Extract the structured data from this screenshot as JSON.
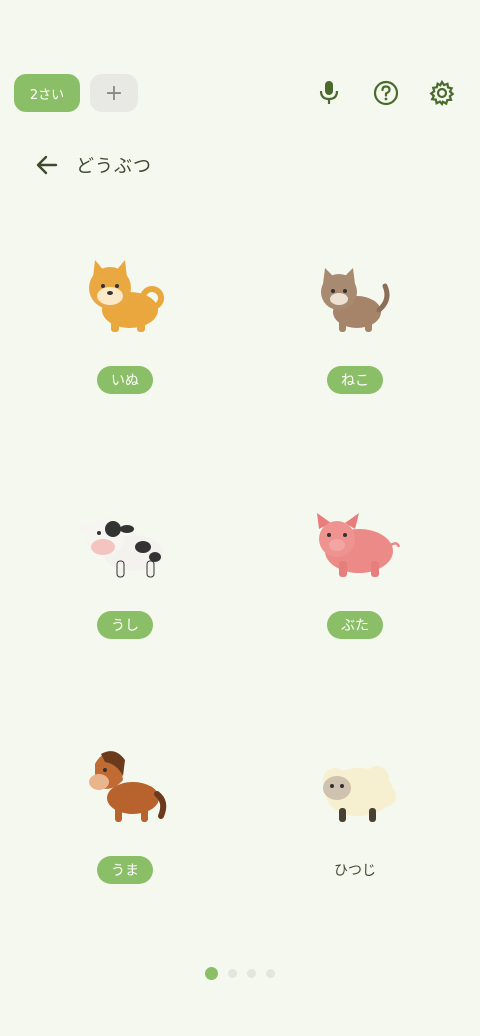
{
  "topbar": {
    "age_chip": "2さい",
    "add_chip": "+"
  },
  "header": {
    "title": "どうぶつ"
  },
  "animals": [
    {
      "label": "いぬ"
    },
    {
      "label": "ねこ"
    },
    {
      "label": "うし"
    },
    {
      "label": "ぶた"
    },
    {
      "label": "うま"
    },
    {
      "label": "ひつじ"
    }
  ],
  "pagination": {
    "current": 1,
    "total": 4
  },
  "colors": {
    "accent": "#8bbf67",
    "background": "#f5f8ef",
    "icon": "#4a6b2c"
  }
}
